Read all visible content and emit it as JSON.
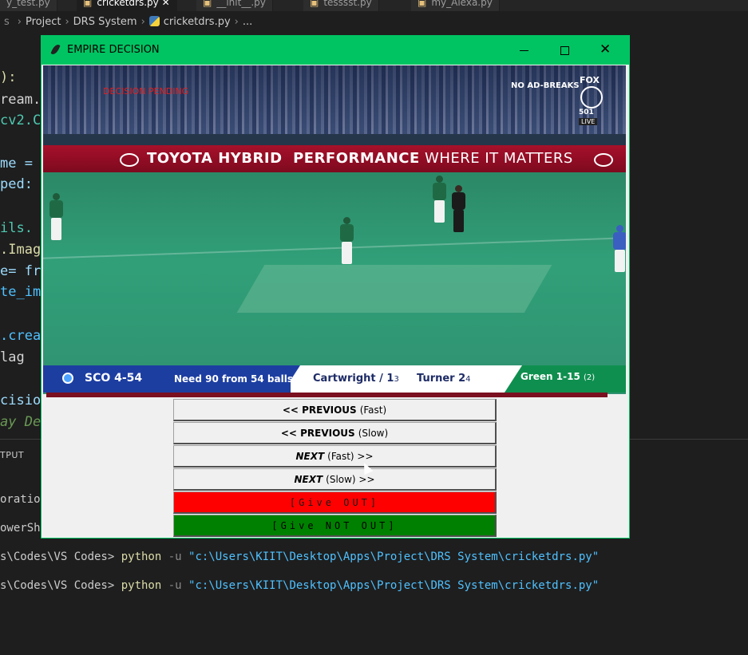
{
  "vscode": {
    "tabs": [
      {
        "label": "y_test.py",
        "active": false
      },
      {
        "label": "cricketdrs.py",
        "active": true
      },
      {
        "label": "__init__.py",
        "active": false
      },
      {
        "label": "tesssst.py",
        "active": false
      },
      {
        "label": "my_Alexa.py",
        "active": false
      }
    ],
    "breadcrumb": [
      "Project",
      "DRS System",
      "cricketdrs.py",
      "..."
    ],
    "code_lines": [
      {
        "text": "):",
        "color": "#dcdcaa"
      },
      {
        "text": "ream.",
        "color": "#d4d4d4"
      },
      {
        "text": "cv2.C",
        "color": "#4ec9b0"
      },
      {
        "text": "me =",
        "color": "#9cdcfe"
      },
      {
        "text": "ped:",
        "color": "#9cdcfe"
      },
      {
        "text": "ils.",
        "color": "#4ec9b0"
      },
      {
        "text": ".Imag",
        "color": "#dcdcaa"
      },
      {
        "text": "e= fr",
        "color": "#9cdcfe"
      },
      {
        "text": "te_im",
        "color": "#4fc1ff"
      },
      {
        "text": ".creat",
        "color": "#4fc1ff"
      },
      {
        "text": "lag",
        "color": "#d4d4d4"
      },
      {
        "text": "cisio",
        "color": "#9cdcfe"
      },
      {
        "text": "ay De",
        "color": "#6a9955"
      }
    ],
    "panel_label": "TPUT",
    "terminal_lines": [
      {
        "text": "oratior"
      },
      {
        "text": "owerShe"
      },
      {
        "prefix": "s\\Codes\\VS Codes> ",
        "cmd": "python",
        "flag": " -u ",
        "path": "\"c:\\Users\\KIIT\\Desktop\\Apps\\Project\\DRS System\\cricketdrs.py\""
      },
      {
        "prefix": "s\\Codes\\VS Codes> ",
        "cmd": "python",
        "flag": " -u ",
        "path": "\"c:\\Users\\KIIT\\Desktop\\Apps\\Project\\DRS System\\cricketdrs.py\""
      }
    ]
  },
  "window": {
    "title": "EMPIRE DECISION",
    "titlebar_color": "#00c462",
    "minimize_icon": "minimize-icon",
    "maximize_icon": "maximize-icon",
    "close_icon": "close-icon"
  },
  "video": {
    "overlay_text": "DECISION PENDING",
    "broadcaster": {
      "noad": "NO AD-BREAKS",
      "logo": "FOX",
      "channel": "501",
      "live": "LIVE"
    },
    "ad_board": {
      "brand": "TOYOTA HYBRID",
      "slogan_bold": "PERFORMANCE",
      "slogan_thin": " WHERE IT MATTERS"
    },
    "scoreboard": {
      "score": "SCO 4-54",
      "need": "Need 90 from 54 balls",
      "batter1": {
        "name": "Cartwright / ",
        "runs": "1",
        "balls": "3"
      },
      "batter2": {
        "name": "Turner   ",
        "runs": "2",
        "balls": "4"
      },
      "bowler": {
        "figures": "Green 1-15",
        "overs": "(2)"
      }
    }
  },
  "buttons": {
    "prev_fast": {
      "bold": "<< PREVIOUS",
      "rest": "(Fast)"
    },
    "prev_slow": {
      "bold": "<< PREVIOUS",
      "rest": "(Slow)"
    },
    "next_fast": {
      "bold": "NEXT",
      "rest": "(Fast) >>"
    },
    "next_slow": {
      "bold": "NEXT",
      "rest": "(Slow) >>"
    },
    "give_out": "[Give OUT]",
    "give_not_out": "[Give NOT OUT]"
  },
  "colors": {
    "out": "#ff0000",
    "not_out": "#008000",
    "accent": "#00c462"
  }
}
